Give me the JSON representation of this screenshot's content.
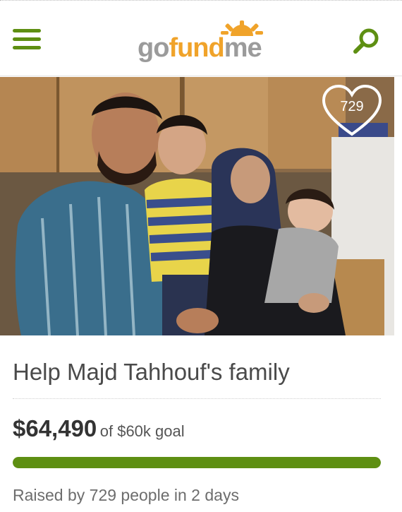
{
  "header": {
    "logo_part1": "go",
    "logo_part2": "fund",
    "logo_part3": "me",
    "colors": {
      "brand_green": "#5e8f12",
      "logo_gray": "#9b9b9b",
      "logo_orange": "#f0a32a"
    }
  },
  "campaign": {
    "heart_count": "729",
    "title": "Help Majd Tahhouf's family",
    "raised_amount": "$64,490",
    "goal_text": "of $60k goal",
    "progress_fraction": 1.0,
    "raised_by_text": "Raised by 729 people in 2 days"
  }
}
